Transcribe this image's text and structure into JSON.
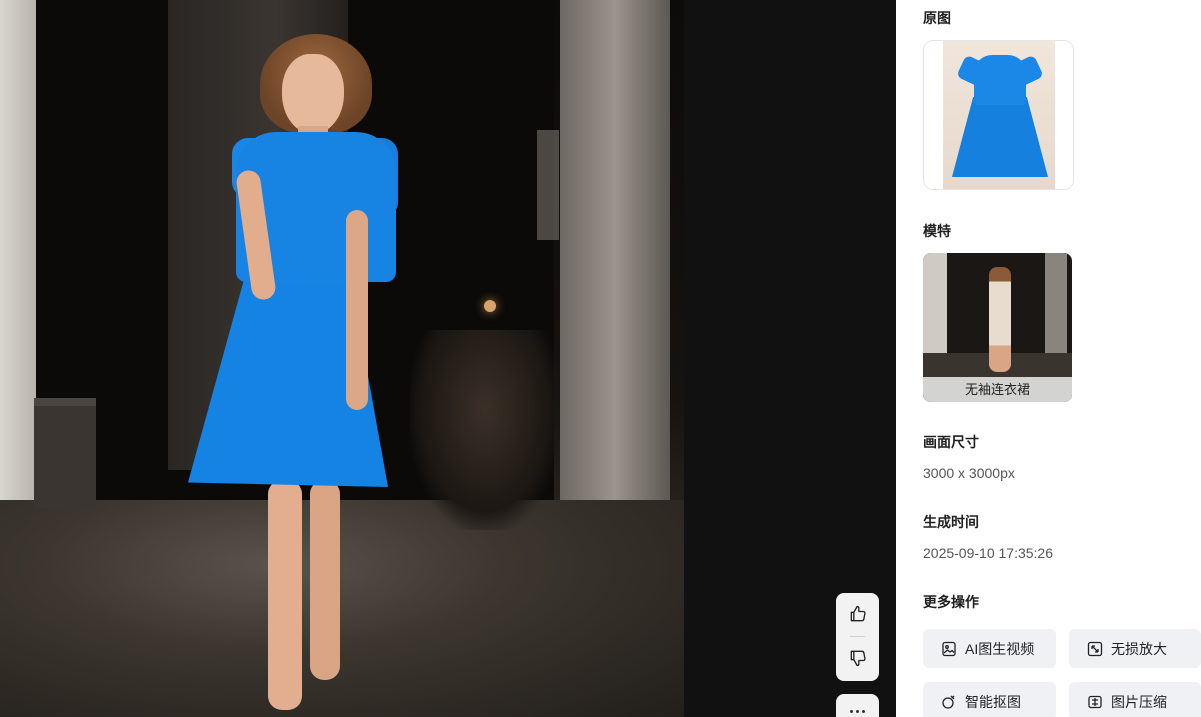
{
  "panel": {
    "original_label": "原图",
    "model_label": "模特",
    "model_name": "无袖连衣裙",
    "size_label": "画面尺寸",
    "size_value": "3000 x 3000px",
    "time_label": "生成时间",
    "time_value": "2025-09-10 17:35:26",
    "more_label": "更多操作",
    "actions": [
      {
        "label": "AI图生视频",
        "icon": "image-to-video-icon"
      },
      {
        "label": "无损放大",
        "icon": "upscale-icon"
      },
      {
        "label": "智能抠图",
        "icon": "cutout-icon"
      },
      {
        "label": "图片压缩",
        "icon": "compress-icon"
      }
    ]
  },
  "feedback": {
    "like_icon": "thumbs-up-icon",
    "dislike_icon": "thumbs-down-icon",
    "more_icon": "more-dots-icon"
  },
  "colors": {
    "dress_blue": "#1784e3",
    "action_bg": "#eff1f5",
    "preview_bg": "#111111"
  }
}
